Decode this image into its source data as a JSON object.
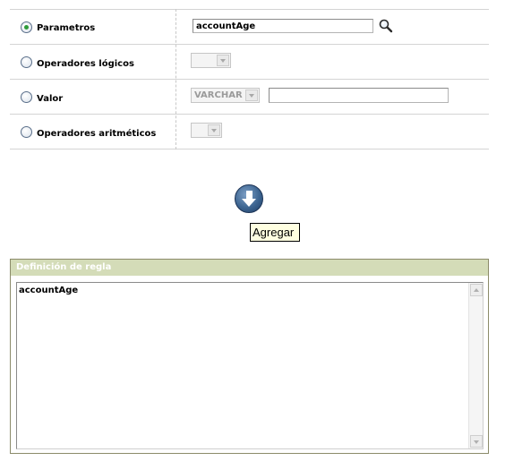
{
  "options": [
    {
      "label": "Parametros",
      "selected": true
    },
    {
      "label": "Operadores lógicos",
      "selected": false
    },
    {
      "label": "Valor",
      "selected": false
    },
    {
      "label": "Operadores aritméticos",
      "selected": false
    }
  ],
  "parametros": {
    "value": "accountAge",
    "icon": "magnifier-icon"
  },
  "operadores_logicos": {
    "selected": ""
  },
  "valor": {
    "type_selected": "VARCHAR",
    "text_value": ""
  },
  "operadores_aritmeticos": {
    "selected": ""
  },
  "agregar": {
    "tooltip": "Agregar",
    "icon": "arrow-down-circle-icon"
  },
  "rule_definition": {
    "title": "Definición de regla",
    "content": "accountAge"
  },
  "colors": {
    "selected_radio": "#2e9b3a",
    "panel_header": "#d4dcb8",
    "tooltip_bg": "#ffffe1"
  }
}
